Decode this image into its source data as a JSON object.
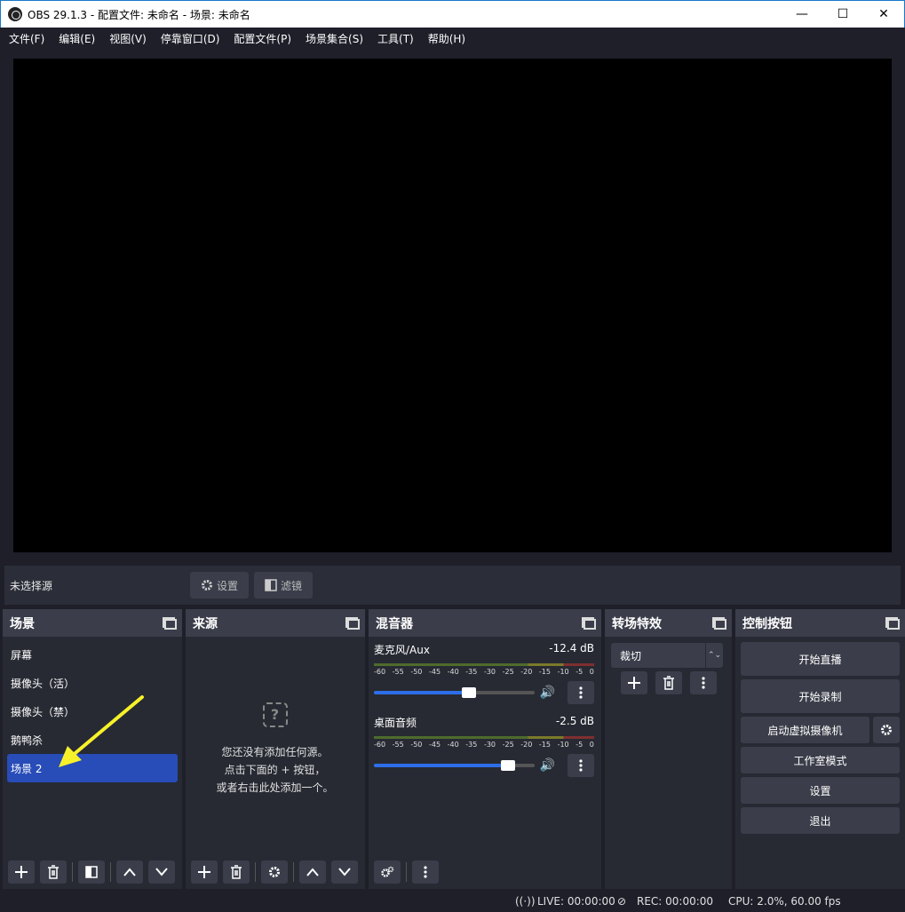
{
  "window": {
    "title": "OBS 29.1.3 - 配置文件: 未命名 - 场景: 未命名",
    "minimize": "—",
    "maximize": "☐",
    "close": "✕"
  },
  "menu": [
    "文件(F)",
    "编辑(E)",
    "视图(V)",
    "停靠窗口(D)",
    "配置文件(P)",
    "场景集合(S)",
    "工具(T)",
    "帮助(H)"
  ],
  "source_bar": {
    "no_source": "未选择源",
    "settings": "设置",
    "filters": "滤镜"
  },
  "scenes": {
    "title": "场景",
    "items": [
      "屏幕",
      "摄像头（活）",
      "摄像头（禁）",
      "鹅鸭杀",
      "场景 2"
    ],
    "selected_index": 4
  },
  "sources": {
    "title": "来源",
    "empty_line1": "您还没有添加任何源。",
    "empty_line2": "点击下面的 + 按钮，",
    "empty_line3": "或者右击此处添加一个。"
  },
  "mixer": {
    "title": "混音器",
    "channels": [
      {
        "name": "麦克风/Aux",
        "db": "-12.4 dB",
        "volume": 0.59
      },
      {
        "name": "桌面音频",
        "db": "-2.5 dB",
        "volume": 0.83
      }
    ],
    "ticks": [
      "-60",
      "-55",
      "-50",
      "-45",
      "-40",
      "-35",
      "-30",
      "-25",
      "-20",
      "-15",
      "-10",
      "-5",
      "0"
    ]
  },
  "transitions": {
    "title": "转场特效",
    "selected": "裁切"
  },
  "controls": {
    "title": "控制按钮",
    "start_stream": "开始直播",
    "start_record": "开始录制",
    "virtual_cam": "启动虚拟摄像机",
    "studio_mode": "工作室模式",
    "settings": "设置",
    "exit": "退出"
  },
  "status": {
    "live": "LIVE: 00:00:00",
    "rec": "REC: 00:00:00",
    "cpu": "CPU: 2.0%, 60.00 fps"
  },
  "colors": {
    "selected": "#284cb8",
    "accent": "#2d6ee8",
    "annotation_arrow": "#f7f12a"
  }
}
